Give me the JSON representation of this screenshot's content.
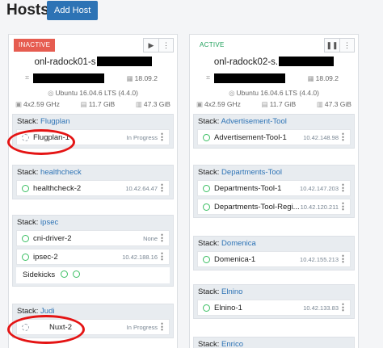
{
  "header": {
    "title": "Hosts",
    "add_host_label": "Add Host"
  },
  "hosts": [
    {
      "state": "INACTIVE",
      "name_visible": "onl-radock01-s",
      "docker_version": "18.09.2",
      "os": "Ubuntu 16.04.6 LTS (4.4.0)",
      "cpu": "4x2.59 GHz",
      "memory": "11.7 GiB",
      "storage": "47.3 GiB",
      "stacks": [
        {
          "label": "Stack:",
          "name": "Flugplan",
          "services": [
            {
              "name": "Flugplan-1",
              "status": "In Progress",
              "state": "progress"
            }
          ]
        },
        {
          "label": "Stack:",
          "name": "healthcheck",
          "services": [
            {
              "name": "healthcheck-2",
              "status": "10.42.64.47",
              "state": "ok"
            }
          ]
        },
        {
          "label": "Stack:",
          "name": "ipsec",
          "services": [
            {
              "name": "cni-driver-2",
              "status": "None",
              "state": "ok"
            },
            {
              "name": "ipsec-2",
              "status": "10.42.188.16",
              "state": "ok"
            }
          ],
          "sidekicks_label": "Sidekicks"
        },
        {
          "label": "Stack:",
          "name": "Judi",
          "services": [
            {
              "name": "Nuxt-2",
              "status": "In Progress",
              "state": "progress"
            }
          ]
        }
      ]
    },
    {
      "state": "ACTIVE",
      "name_visible": "onl-radock02-s.",
      "docker_version": "18.09.2",
      "os": "Ubuntu 16.04.6 LTS (4.4.0)",
      "cpu": "4x2.59 GHz",
      "memory": "11.7 GiB",
      "storage": "47.3 GiB",
      "stacks": [
        {
          "label": "Stack:",
          "name": "Advertisement-Tool",
          "services": [
            {
              "name": "Advertisement-Tool-1",
              "status": "10.42.148.98",
              "state": "ok"
            }
          ]
        },
        {
          "label": "Stack:",
          "name": "Departments-Tool",
          "services": [
            {
              "name": "Departments-Tool-1",
              "status": "10.42.147.203",
              "state": "ok"
            },
            {
              "name": "Departments-Tool-Regi...",
              "status": "10.42.120.211",
              "state": "ok"
            }
          ]
        },
        {
          "label": "Stack:",
          "name": "Domenica",
          "services": [
            {
              "name": "Domenica-1",
              "status": "10.42.155.213",
              "state": "ok"
            }
          ]
        },
        {
          "label": "Stack:",
          "name": "Elnino",
          "services": [
            {
              "name": "Elnino-1",
              "status": "10.42.133.83",
              "state": "ok"
            }
          ]
        },
        {
          "label": "Stack:",
          "name": "Enrico",
          "services": []
        }
      ]
    }
  ],
  "colors": {
    "accent": "#2d73b5",
    "inactive": "#e65c50",
    "active": "#1fa05b",
    "service_ok": "#3bbf63",
    "annotation": "#e41414"
  },
  "icons": {
    "play": "play-icon",
    "pause": "pause-icon",
    "more": "kebab-menu-icon",
    "tag": "tag-icon",
    "docker": "docker-icon",
    "os": "ubuntu-icon",
    "cpu": "cpu-icon",
    "memory": "memory-icon",
    "storage": "storage-icon"
  }
}
